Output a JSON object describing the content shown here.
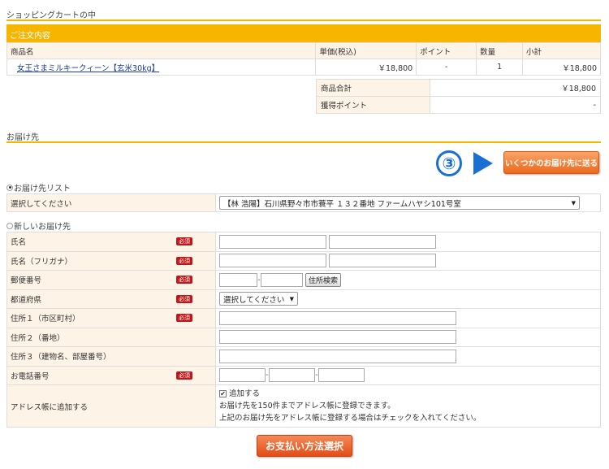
{
  "cart_section": {
    "title": "ショッピングカートの中",
    "header": "ご注文内容"
  },
  "cart_table": {
    "columns": [
      "商品名",
      "単価(税込)",
      "ポイント",
      "数量",
      "小計"
    ],
    "rows": [
      {
        "name": "女王さまミルキークィーン【玄米30kg】",
        "price": "￥18,800",
        "points": "-",
        "qty": "1",
        "subtotal": "￥18,800"
      }
    ]
  },
  "totals": {
    "subtotal_label": "商品合計",
    "subtotal_value": "￥18,800",
    "points_label": "獲得ポイント",
    "points_value": "-"
  },
  "delivery": {
    "title": "お届け先",
    "step_number": "③",
    "multi_button": "いくつかのお届け先に送る",
    "list_radio": "お届け先リスト",
    "list_label": "選択してください",
    "list_selected": "【林 浩陽】石川県野々市市蓑平 １３２番地 ファームハヤシ101号室",
    "new_radio": "新しいお届け先"
  },
  "form": {
    "required_badge": "必須",
    "name_label": "氏名",
    "kana_label": "氏名（フリガナ）",
    "zip_label": "郵便番号",
    "zip_search_button": "住所検索",
    "pref_label": "都道府県",
    "pref_placeholder": "選択してください",
    "addr1_label": "住所１（市区町村）",
    "addr2_label": "住所２（番地）",
    "addr3_label": "住所３（建物名、部屋番号）",
    "phone_label": "お電話番号",
    "addressbook_label": "アドレス帳に追加する",
    "addressbook_check": "追加する",
    "addressbook_note1": "お届け先を150件までアドレス帳に登録できます。",
    "addressbook_note2": "上記のお届け先をアドレス帳に登録する場合はチェックを入れてください。"
  },
  "pay_button": "お支払い方法選択",
  "colors": {
    "accent": "#f7b500",
    "orange_button": "#ec6a1c",
    "step_blue": "#1a6fd4",
    "required_red": "#c0161a"
  }
}
